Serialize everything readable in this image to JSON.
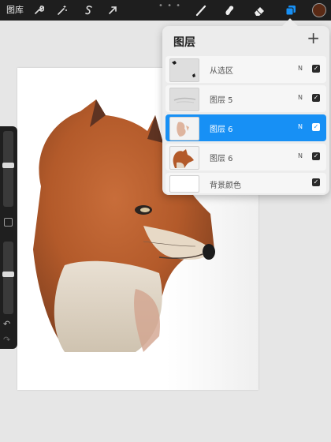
{
  "toolbar": {
    "gallery_label": "图库",
    "more": "• • •",
    "tools_left": [
      "wrench-icon",
      "magic-wand-icon",
      "selection-s-icon",
      "transform-arrow-icon"
    ],
    "tools_right": [
      "brush-icon",
      "smudge-icon",
      "eraser-icon",
      "layers-icon"
    ],
    "active_tool": "layers-icon",
    "current_color": "#5a2a15"
  },
  "layers_panel": {
    "title": "图层",
    "add_symbol": "+",
    "accent": "#1790f5",
    "layers": [
      {
        "name": "从选区",
        "blend": "N",
        "visible": true,
        "selected": false
      },
      {
        "name": "图层 5",
        "blend": "N",
        "visible": true,
        "selected": false
      },
      {
        "name": "图层 6",
        "blend": "N",
        "visible": true,
        "selected": true
      },
      {
        "name": "图层 6",
        "blend": "N",
        "visible": true,
        "selected": false
      },
      {
        "name": "背景颜色",
        "blend": "",
        "visible": true,
        "selected": false
      }
    ]
  },
  "sidebar": {
    "brush_size_level": 0.55,
    "opacity_level": 0.55,
    "undo_symbol": "↶",
    "redo_symbol": "↷"
  }
}
